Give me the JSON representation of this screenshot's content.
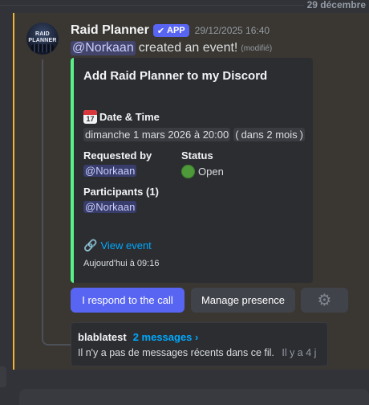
{
  "divider": {
    "date": "29 décembre"
  },
  "message": {
    "author": "Raid Planner",
    "avatar_text": "RAID PLANNER",
    "app_tag": "APP",
    "timestamp": "29/12/2025 16:40",
    "mention": "@Norkaan",
    "text": "created an event!",
    "edited": "(modifié)"
  },
  "embed": {
    "title": "Add Raid Planner to my Discord",
    "date_field": {
      "icon_day": "17",
      "name": "Date & Time",
      "value": "dimanche 1 mars 2026 à 20:00",
      "relative": "dans 2 mois"
    },
    "requested_by": {
      "name": "Requested by",
      "value": "@Norkaan"
    },
    "status": {
      "name": "Status",
      "value": "Open"
    },
    "participants": {
      "name": "Participants (1)",
      "value": "@Norkaan"
    },
    "link": {
      "icon": "link-icon",
      "text": "View event"
    },
    "footer": "Aujourd'hui à 09:16",
    "accent_color": "#57f287"
  },
  "buttons": {
    "respond": "I respond to the call",
    "manage": "Manage presence",
    "settings_icon": "gear-icon"
  },
  "thread": {
    "name": "blablatest",
    "count": "2 messages ›",
    "preview": "Il n'y a pas de messages récents dans ce fil.",
    "ago": "Il y a 4 j"
  },
  "colors": {
    "brand": "#5865f2",
    "link": "#00a8fc",
    "mention_bar": "#f0b232"
  }
}
